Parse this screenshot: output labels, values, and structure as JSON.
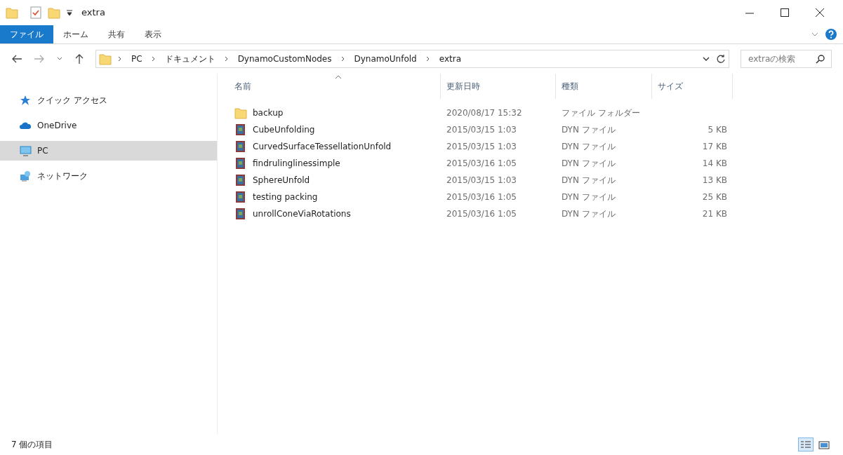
{
  "window": {
    "title": "extra"
  },
  "ribbon_tabs": [
    {
      "label": "ファイル",
      "kind": "file"
    },
    {
      "label": "ホーム",
      "kind": "tab"
    },
    {
      "label": "共有",
      "kind": "tab"
    },
    {
      "label": "表示",
      "kind": "tab"
    }
  ],
  "address_bar": {
    "path": [
      "PC",
      "ドキュメント",
      "DynamoCustomNodes",
      "DynamoUnfold",
      "extra"
    ]
  },
  "search": {
    "placeholder": "extraの検索"
  },
  "sidebar": {
    "items": [
      {
        "label": "クイック アクセス",
        "kind": "star",
        "selected": false
      },
      {
        "label": "OneDrive",
        "kind": "cloud",
        "selected": false
      },
      {
        "label": "PC",
        "kind": "pc",
        "selected": true
      },
      {
        "label": "ネットワーク",
        "kind": "network",
        "selected": false
      }
    ]
  },
  "table": {
    "columns": [
      {
        "label": "名前",
        "sorted": true
      },
      {
        "label": "更新日時",
        "sorted": false
      },
      {
        "label": "種類",
        "sorted": false
      },
      {
        "label": "サイズ",
        "sorted": false
      }
    ],
    "rows": [
      {
        "kind": "folder",
        "name": "backup",
        "modified": "2020/08/17 15:32",
        "type": "ファイル フォルダー",
        "size": ""
      },
      {
        "kind": "dyn",
        "name": "CubeUnfolding",
        "modified": "2015/03/15 1:03",
        "type": "DYN ファイル",
        "size": "5 KB"
      },
      {
        "kind": "dyn",
        "name": "CurvedSurfaceTessellationUnfold",
        "modified": "2015/03/15 1:03",
        "type": "DYN ファイル",
        "size": "17 KB"
      },
      {
        "kind": "dyn",
        "name": "findrulinglinessimple",
        "modified": "2015/03/16 1:05",
        "type": "DYN ファイル",
        "size": "14 KB"
      },
      {
        "kind": "dyn",
        "name": "SphereUnfold",
        "modified": "2015/03/15 1:03",
        "type": "DYN ファイル",
        "size": "13 KB"
      },
      {
        "kind": "dyn",
        "name": "testing packing",
        "modified": "2015/03/16 1:05",
        "type": "DYN ファイル",
        "size": "25 KB"
      },
      {
        "kind": "dyn",
        "name": "unrollConeViaRotations",
        "modified": "2015/03/16 1:05",
        "type": "DYN ファイル",
        "size": "21 KB"
      }
    ]
  },
  "status_bar": {
    "count": "7 個の項目",
    "views": [
      {
        "kind": "details",
        "selected": true
      },
      {
        "kind": "large",
        "selected": false
      }
    ]
  }
}
